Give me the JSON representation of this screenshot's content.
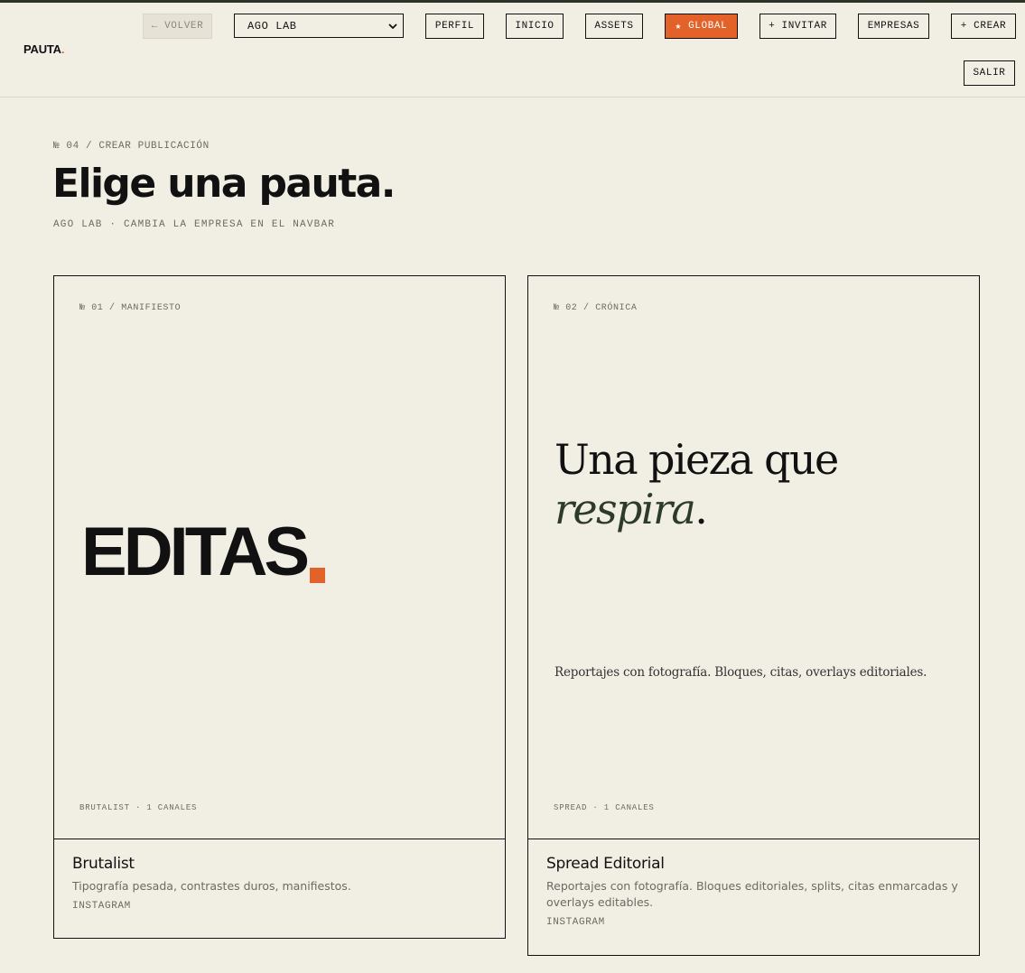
{
  "brand": {
    "name": "PAUTA",
    "dot": "."
  },
  "nav": {
    "back_arrow": "←",
    "back_label": "VOLVER",
    "company_selected": "AGO LAB",
    "perfil": "PERFIL",
    "inicio": "INICIO",
    "assets": "ASSETS",
    "global_star": "★",
    "global_label": "GLOBAL",
    "invitar": "+ INVITAR",
    "empresas": "EMPRESAS",
    "crear": "+ CREAR",
    "salir": "SALIR"
  },
  "header": {
    "crumb": "№ 04 / CREAR PUBLICACIÓN",
    "title": "Elige una pauta.",
    "subtitle": "AGO LAB · CAMBIA LA EMPRESA EN EL NAVBAR"
  },
  "templates": [
    {
      "number": "№ 01 / MANIFIESTO",
      "preview_word": "EDITAS",
      "footer": "BRUTALIST · 1 CANALES",
      "name": "Brutalist",
      "description": "Tipografía pesada, contrastes duros, manifiestos.",
      "channel": "INSTAGRAM"
    },
    {
      "number": "№ 02 / CRÓNICA",
      "headline_line1": "Una pieza que",
      "headline_italic": "respira",
      "headline_period": ".",
      "preview_description": "Reportajes con fotografía. Bloques, citas, overlays editoriales.",
      "footer": "SPREAD · 1 CANALES",
      "name": "Spread Editorial",
      "description": "Reportajes con fotografía. Bloques editoriales, splits, citas enmarcadas y overlays editables.",
      "channel": "INSTAGRAM"
    }
  ],
  "colors": {
    "background": "#f1eee4",
    "accent": "#e2622a",
    "ink": "#111111",
    "muted": "#6c6a63",
    "italic_green": "#2d3b2a"
  }
}
